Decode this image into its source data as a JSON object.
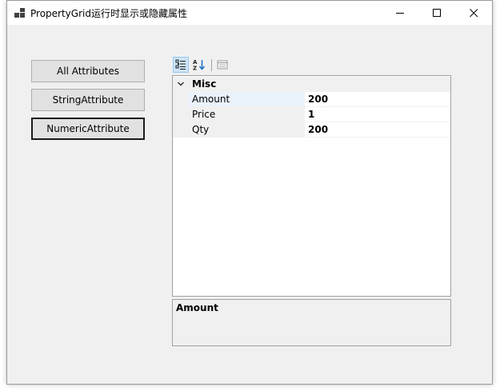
{
  "window": {
    "title": "PropertyGrid运行时显示或隐藏属性"
  },
  "buttons": {
    "all_attributes": "All Attributes",
    "string_attribute": "StringAttribute",
    "numeric_attribute": "NumericAttribute"
  },
  "toolbar": {
    "categorized_icon": "categorized-icon",
    "alphabetical_icon": "sort-az-icon",
    "property_pages_icon": "property-pages-icon"
  },
  "property_grid": {
    "category": "Misc",
    "properties": [
      {
        "name": "Amount",
        "value": "200"
      },
      {
        "name": "Price",
        "value": "1"
      },
      {
        "name": "Qty",
        "value": "200"
      }
    ]
  },
  "help_pane": {
    "title": "Amount"
  }
}
